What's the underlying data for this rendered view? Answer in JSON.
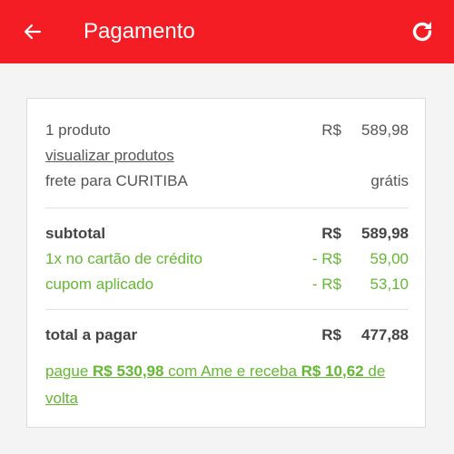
{
  "header": {
    "title": "Pagamento",
    "back_icon": "arrow-left-icon",
    "refresh_icon": "refresh-icon",
    "bg_color": "#f41d24"
  },
  "summary": {
    "product_count": "1 produto",
    "product_currency": "R$",
    "product_value": "589,98",
    "view_products_link": "visualizar produtos",
    "shipping_label": "frete para CURITIBA",
    "shipping_value": "grátis"
  },
  "totals": {
    "subtotal_label": "subtotal",
    "subtotal_currency": "R$",
    "subtotal_value": "589,98",
    "card_discount_label": "1x no cartão de crédito",
    "card_discount_currency": "- R$",
    "card_discount_value": "59,00",
    "coupon_label": "cupom aplicado",
    "coupon_currency": "- R$",
    "coupon_value": "53,10",
    "discount_color": "#64b832"
  },
  "final": {
    "total_label": "total a pagar",
    "total_currency": "R$",
    "total_value": "477,88",
    "ame_text_1": "pague ",
    "ame_amount": "R$ 530,98",
    "ame_text_2": " com Ame e receba ",
    "ame_cashback": "R$ 10,62",
    "ame_text_3": " de volta"
  }
}
